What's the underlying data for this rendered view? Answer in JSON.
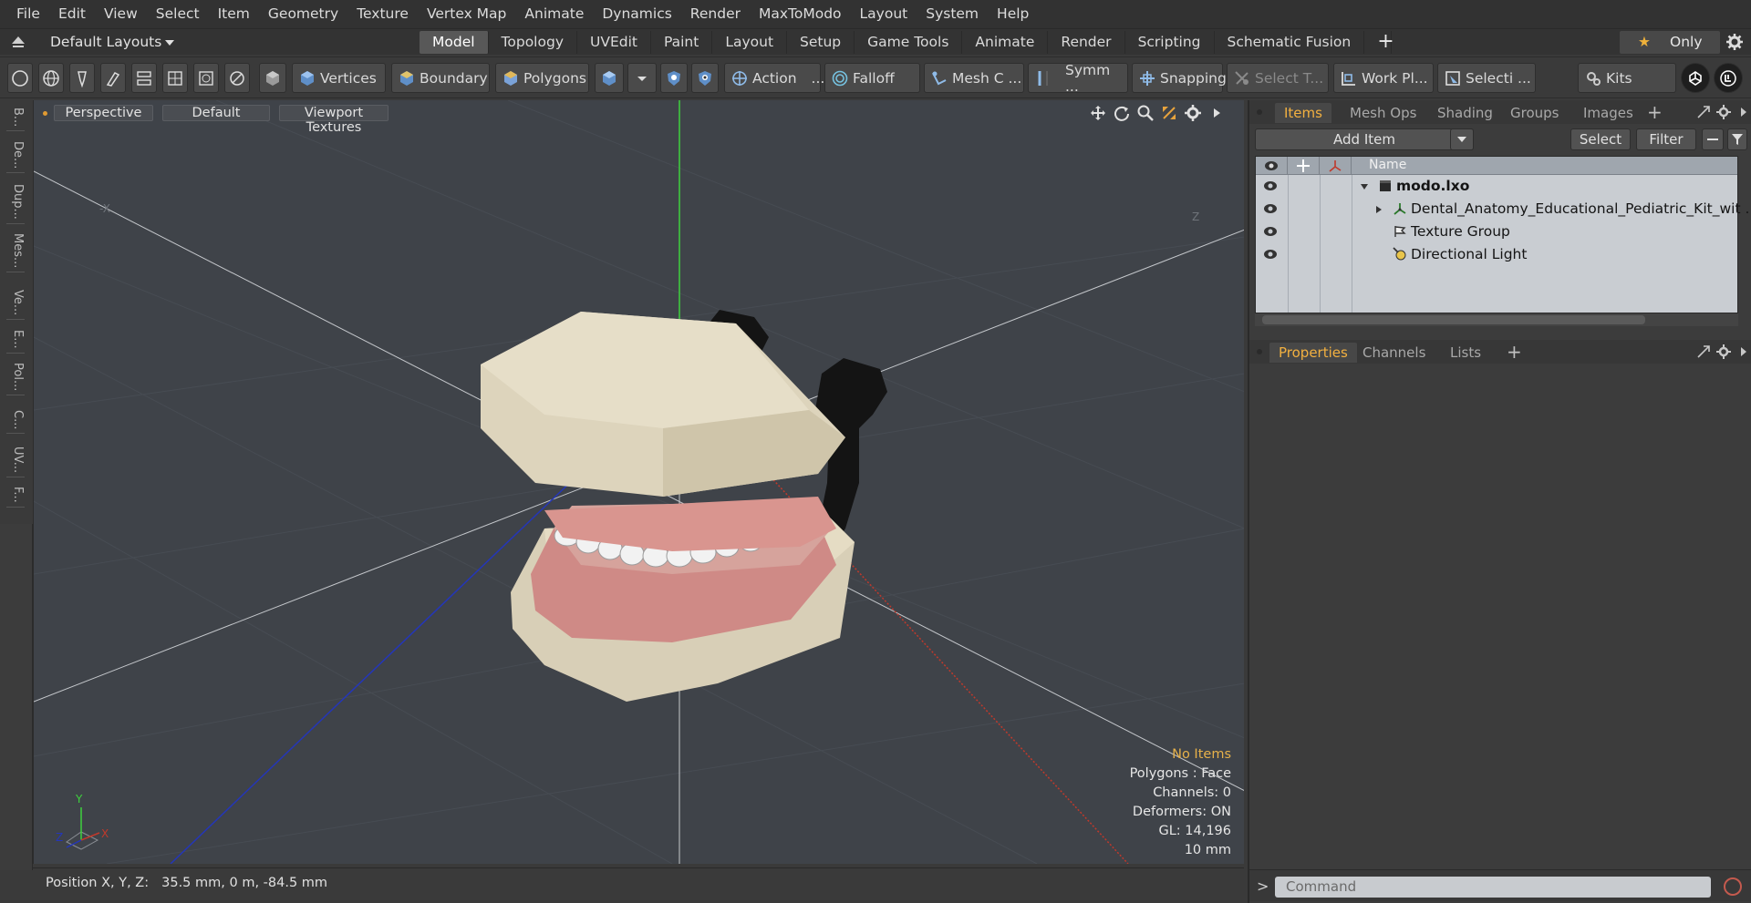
{
  "menu": [
    "File",
    "Edit",
    "View",
    "Select",
    "Item",
    "Geometry",
    "Texture",
    "Vertex Map",
    "Animate",
    "Dynamics",
    "Render",
    "MaxToModo",
    "Layout",
    "System",
    "Help"
  ],
  "layout": {
    "default_layouts": "Default Layouts",
    "tabs": [
      "Model",
      "Topology",
      "UVEdit",
      "Paint",
      "Layout",
      "Setup",
      "Game Tools",
      "Animate",
      "Render",
      "Scripting",
      "Schematic Fusion"
    ],
    "active_tab": "Model",
    "only_label": "Only"
  },
  "toolbar": {
    "vertices": "Vertices",
    "boundary": "Boundary",
    "polygons": "Polygons",
    "action": "Action",
    "action_more": "...",
    "falloff": "Falloff",
    "meshc": "Mesh C ...",
    "symm": "Symm ...",
    "snapping": "Snapping",
    "selectt": "Select T...",
    "workpl": "Work Pl...",
    "selecti": "Selecti ...",
    "kits": "Kits"
  },
  "left_tabs": [
    "B...",
    "De...",
    "Dup...",
    "Mes...",
    "Ve...",
    "E...",
    "Pol...",
    "C...",
    "UV...",
    "F..."
  ],
  "viewport": {
    "perspective": "Perspective",
    "default": "Default",
    "viewport_textures": "Viewport Textures",
    "axis_labels": {
      "x": "X",
      "y": "Y",
      "z": "Z"
    },
    "info": {
      "no_items": "No Items",
      "polygons": "Polygons : Face",
      "channels": "Channels: 0",
      "deformers": "Deformers: ON",
      "gl": "GL: 14,196",
      "unit": "10 mm"
    }
  },
  "status": {
    "label": "Position X, Y, Z:",
    "value": "35.5 mm, 0 m, -84.5 mm"
  },
  "items_panel": {
    "tabs": [
      "Items",
      "Mesh Ops",
      "Shading",
      "Groups",
      "Images"
    ],
    "active_tab": "Items",
    "add_item": "Add Item",
    "select": "Select",
    "filter": "Filter",
    "name_header": "Name",
    "rows": [
      {
        "label": "modo.lxo",
        "icon": "scene-icon"
      },
      {
        "label": "Dental_Anatomy_Educational_Pediatric_Kit_wit ...",
        "icon": "mesh-locator-icon"
      },
      {
        "label": "Texture Group",
        "icon": "texture-group-icon"
      },
      {
        "label": "Directional Light",
        "icon": "directional-light-icon"
      }
    ]
  },
  "properties_panel": {
    "tabs": [
      "Properties",
      "Channels",
      "Lists"
    ],
    "active_tab": "Properties"
  },
  "command": {
    "prompt": ">",
    "placeholder": "Command"
  },
  "colors": {
    "accent": "#f2b040",
    "viewport_bg": "#3f4349",
    "axis_y": "#3ed13e",
    "axis_x": "#c0392b",
    "axis_z": "#2436b8"
  }
}
